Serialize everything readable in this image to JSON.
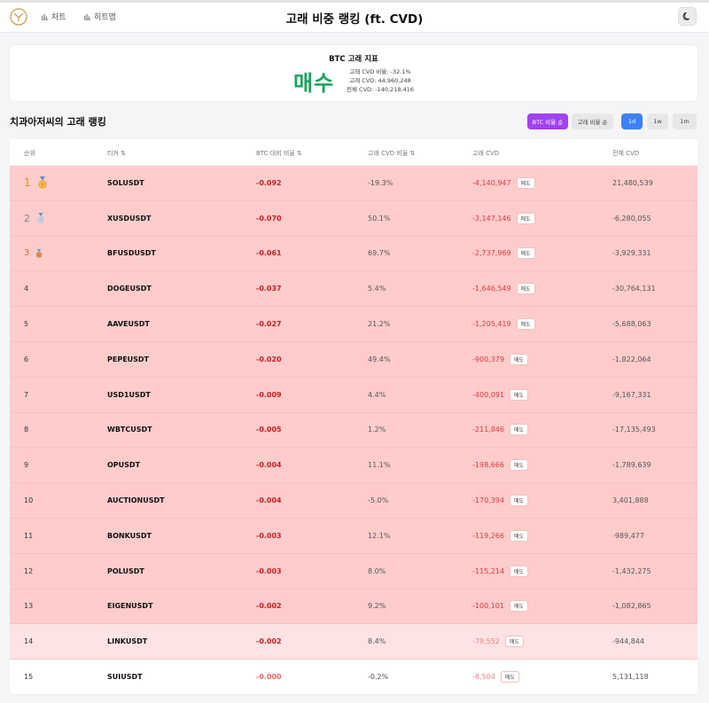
{
  "header": {
    "title": "고래 비중 랭킹 (ft. CVD)",
    "nav": [
      {
        "label": "차트",
        "icon": "bar-chart-icon"
      },
      {
        "label": "히트맵",
        "icon": "bar-chart-icon"
      }
    ],
    "logo_icon": "logo-icon",
    "theme_icon": "moon-icon"
  },
  "indicator": {
    "title": "BTC 고래 지표",
    "signal": "매수",
    "signal_color": "#1aa35c",
    "stats": [
      "고래 CVD 비율: -32.1%",
      "고래 CVD: 44,960,248",
      "전체 CVD: -140,218,416"
    ]
  },
  "ranking": {
    "title": "치과아저씨의 고래 랭킹",
    "sort_buttons": [
      "BTC 비율 순",
      "고래 비율 순"
    ],
    "period_buttons": [
      "1d",
      "1w",
      "1m"
    ],
    "active_sort": "BTC 비율 순",
    "active_period": "1d",
    "columns": [
      "순위",
      "티커 ⇅",
      "BTC 대비 비율 ⇅",
      "고래 CVD 비율 ⇅",
      "고래 CVD",
      "전체 CVD"
    ],
    "rows": [
      {
        "rank": "1",
        "ticker": "SOLUSDT",
        "btc": "-0.092",
        "ratio": "-19.3%",
        "wcvd": "-4,140,947",
        "side": "매도",
        "tcvd": "21,480,539"
      },
      {
        "rank": "2",
        "ticker": "XUSDUSDT",
        "btc": "-0.070",
        "ratio": "50.1%",
        "wcvd": "-3,147,146",
        "side": "매도",
        "tcvd": "-6,280,055"
      },
      {
        "rank": "3",
        "ticker": "BFUSDUSDT",
        "btc": "-0.061",
        "ratio": "69.7%",
        "wcvd": "-2,737,969",
        "side": "매도",
        "tcvd": "-3,929,331"
      },
      {
        "rank": "4",
        "ticker": "DOGEUSDT",
        "btc": "-0.037",
        "ratio": "5.4%",
        "wcvd": "-1,646,549",
        "side": "매도",
        "tcvd": "-30,764,131"
      },
      {
        "rank": "5",
        "ticker": "AAVEUSDT",
        "btc": "-0.027",
        "ratio": "21.2%",
        "wcvd": "-1,205,419",
        "side": "매도",
        "tcvd": "-5,688,063"
      },
      {
        "rank": "6",
        "ticker": "PEPEUSDT",
        "btc": "-0.020",
        "ratio": "49.4%",
        "wcvd": "-900,379",
        "side": "매도",
        "tcvd": "-1,822,064"
      },
      {
        "rank": "7",
        "ticker": "USD1USDT",
        "btc": "-0.009",
        "ratio": "4.4%",
        "wcvd": "-400,091",
        "side": "매도",
        "tcvd": "-9,167,331"
      },
      {
        "rank": "8",
        "ticker": "WBTCUSDT",
        "btc": "-0.005",
        "ratio": "1.2%",
        "wcvd": "-211,846",
        "side": "매도",
        "tcvd": "-17,135,493"
      },
      {
        "rank": "9",
        "ticker": "OPUSDT",
        "btc": "-0.004",
        "ratio": "11.1%",
        "wcvd": "-198,666",
        "side": "매도",
        "tcvd": "-1,789,639"
      },
      {
        "rank": "10",
        "ticker": "AUCTIONUSDT",
        "btc": "-0.004",
        "ratio": "-5.0%",
        "wcvd": "-170,394",
        "side": "매도",
        "tcvd": "3,401,888"
      },
      {
        "rank": "11",
        "ticker": "BONKUSDT",
        "btc": "-0.003",
        "ratio": "12.1%",
        "wcvd": "-119,266",
        "side": "매도",
        "tcvd": "-989,477"
      },
      {
        "rank": "12",
        "ticker": "POLUSDT",
        "btc": "-0.003",
        "ratio": "8.0%",
        "wcvd": "-115,214",
        "side": "매도",
        "tcvd": "-1,432,275"
      },
      {
        "rank": "13",
        "ticker": "EIGENUSDT",
        "btc": "-0.002",
        "ratio": "9.2%",
        "wcvd": "-100,101",
        "side": "매도",
        "tcvd": "-1,082,865"
      },
      {
        "rank": "14",
        "ticker": "LINKUSDT",
        "btc": "-0.002",
        "ratio": "8.4%",
        "wcvd": "-79,552",
        "side": "매도",
        "tcvd": "-944,844"
      },
      {
        "rank": "15",
        "ticker": "SUIUSDT",
        "btc": "-0.000",
        "ratio": "-0.2%",
        "wcvd": "-8,504",
        "side": "매도",
        "tcvd": "5,131,118"
      }
    ]
  },
  "colors": {
    "row_strong": "#ffcccc",
    "row_mid": "#fde3e3",
    "negative_text": "#c81e1e",
    "accent_purple": "#a042f0",
    "accent_blue": "#3b82f6"
  }
}
